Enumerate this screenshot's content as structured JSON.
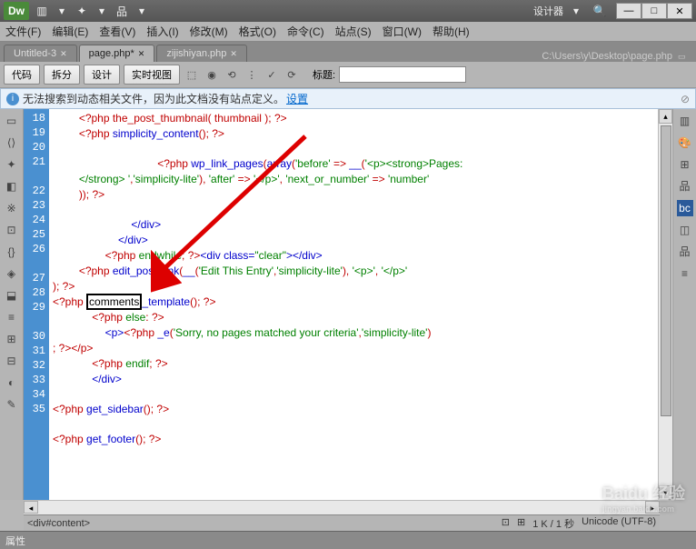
{
  "title": {
    "logo": "Dw",
    "designer": "设计器"
  },
  "menu": [
    "文件(F)",
    "编辑(E)",
    "查看(V)",
    "插入(I)",
    "修改(M)",
    "格式(O)",
    "命令(C)",
    "站点(S)",
    "窗口(W)",
    "帮助(H)"
  ],
  "tabs": [
    {
      "label": "Untitled-3",
      "active": false
    },
    {
      "label": "page.php*",
      "active": true
    },
    {
      "label": "zijishiyan.php",
      "active": false
    }
  ],
  "path": "C:\\Users\\y\\Desktop\\page.php",
  "toolbar": {
    "code": "代码",
    "split": "拆分",
    "design": "设计",
    "live": "实时视图",
    "titleLabel": "标题:",
    "titleValue": ""
  },
  "info": {
    "msg": "无法搜索到动态相关文件，因为此文档没有站点定义。",
    "link": "设置"
  },
  "lines": [
    18,
    19,
    20,
    21,
    "",
    22,
    23,
    24,
    25,
    26,
    "",
    27,
    28,
    29,
    "",
    30,
    31,
    32,
    33,
    34,
    35
  ],
  "code": {
    "l18": "<?php the_post_thumbnail( thumbnail ); ?>",
    "l19": {
      "p1": "<?php ",
      "fn": "simplicity_content",
      "p2": "(); ?>"
    },
    "l21_1": {
      "p1": "<?php ",
      "fn": "wp_link_pages",
      "p2": "(",
      "fn2": "array",
      "p3": "(",
      "s1": "'before'",
      "ar": " => ",
      "fn3": "__",
      "p4": "(",
      "s2": "'<p><strong>Pages:"
    },
    "l21_2": {
      "s1": "</strong> '",
      "c": ",",
      "s2": "'simplicity-lite'",
      "p1": "), ",
      "s3": "'after'",
      "ar": " => ",
      "s4": "'</p>'",
      "c2": ", ",
      "s5": "'next_or_number'",
      "ar2": " => ",
      "s6": "'number'"
    },
    "l21_3": ")); ?>",
    "l23": "</div>",
    "l24": "</div>",
    "l25": {
      "p1": "<?php ",
      "kw": "endwhile",
      "p2": "; ?>",
      "t1": "<div class=",
      "s1": "\"clear\"",
      "t2": "></div>"
    },
    "l26": {
      "p1": "<?php ",
      "fn": "edit_post_link",
      "p2": "(",
      "fn2": "__",
      "p3": "(",
      "s1": "'Edit This Entry'",
      "c": ",",
      "s2": "'simplicity-lite'",
      "p4": "), ",
      "s3": "'<p>'",
      "c2": ", ",
      "s4": "'</p>'"
    },
    "l26_2": "); ?>",
    "l27": {
      "p1": "<?php ",
      "box": "comments",
      "fn": "_template",
      "p2": "(); ?>"
    },
    "l28": {
      "p1": "<?php ",
      "kw": "else",
      "p2": ": ?>"
    },
    "l29": {
      "t1": "<p>",
      "p1": "<?php ",
      "fn": "_e",
      "p2": "(",
      "s1": "'Sorry, no pages matched your criteria'",
      "c": ",",
      "s2": "'simplicity-lite'",
      "p3": ")"
    },
    "l29_2": "; ?></p>",
    "l30": {
      "p1": "<?php ",
      "kw": "endif",
      "p2": "; ?>"
    },
    "l31": "</div>",
    "l33": {
      "p1": "<?php ",
      "fn": "get_sidebar",
      "p2": "(); ?>"
    },
    "l35": {
      "p1": "<?php ",
      "fn": "get_footer",
      "p2": "(); ?>"
    }
  },
  "status": {
    "element": "<div#content>",
    "size": "1 K / 1 秒",
    "enc": "Unicode (UTF-8)"
  },
  "props": "属性",
  "watermark": {
    "big": "Baidu 经验",
    "small": "jingyan.baidu.com"
  }
}
